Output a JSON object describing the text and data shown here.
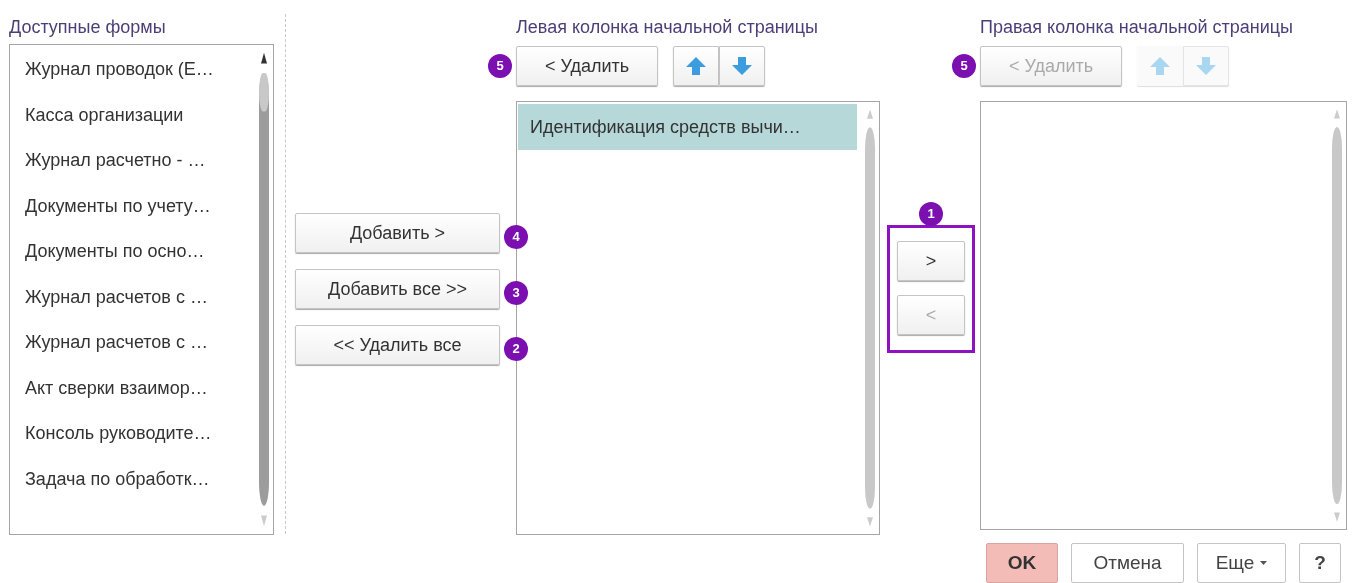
{
  "available_forms": {
    "label": "Доступные формы",
    "items": [
      {
        "text": "Журнал проводок (Е…",
        "selected": false
      },
      {
        "text": "Касса организации",
        "selected": false
      },
      {
        "text": "Журнал расчетно - …",
        "selected": false
      },
      {
        "text": "Документы по учету…",
        "selected": false
      },
      {
        "text": "Документы по осно…",
        "selected": false
      },
      {
        "text": "Журнал расчетов с …",
        "selected": false
      },
      {
        "text": "Журнал расчетов с …",
        "selected": false
      },
      {
        "text": "Акт сверки взаимор…",
        "selected": false
      },
      {
        "text": "Консоль руководите…",
        "selected": false
      },
      {
        "text": "Задача по обработк…",
        "selected": false
      }
    ]
  },
  "add_buttons": [
    {
      "label": "Добавить >",
      "badge": "4",
      "disabled": false
    },
    {
      "label": "Добавить все >>",
      "badge": "3",
      "disabled": false
    },
    {
      "label": "<< Удалить все",
      "badge": "2",
      "disabled": false
    }
  ],
  "left_column": {
    "label": "Левая колонка начальной страницы",
    "remove_button": {
      "label": "< Удалить",
      "badge": "5",
      "disabled": false
    },
    "move_up": {
      "disabled": false
    },
    "move_down": {
      "disabled": false
    },
    "items": [
      {
        "text": "Идентификация средств вычи…",
        "selected": true
      }
    ]
  },
  "transfer": {
    "badge": "1",
    "buttons": [
      {
        "label": ">",
        "disabled": false
      },
      {
        "label": "<",
        "disabled": true
      }
    ]
  },
  "right_column": {
    "label": "Правая колонка начальной страницы",
    "remove_button": {
      "label": "< Удалить",
      "badge": "5",
      "disabled": true
    },
    "move_up": {
      "disabled": true
    },
    "move_down": {
      "disabled": true
    }
  },
  "footer_buttons": [
    {
      "label": "OK",
      "kind": "primary"
    },
    {
      "label": "Отмена",
      "kind": "normal"
    },
    {
      "label": "Еще",
      "kind": "dropdown"
    },
    {
      "label": "?",
      "kind": "normal"
    }
  ]
}
